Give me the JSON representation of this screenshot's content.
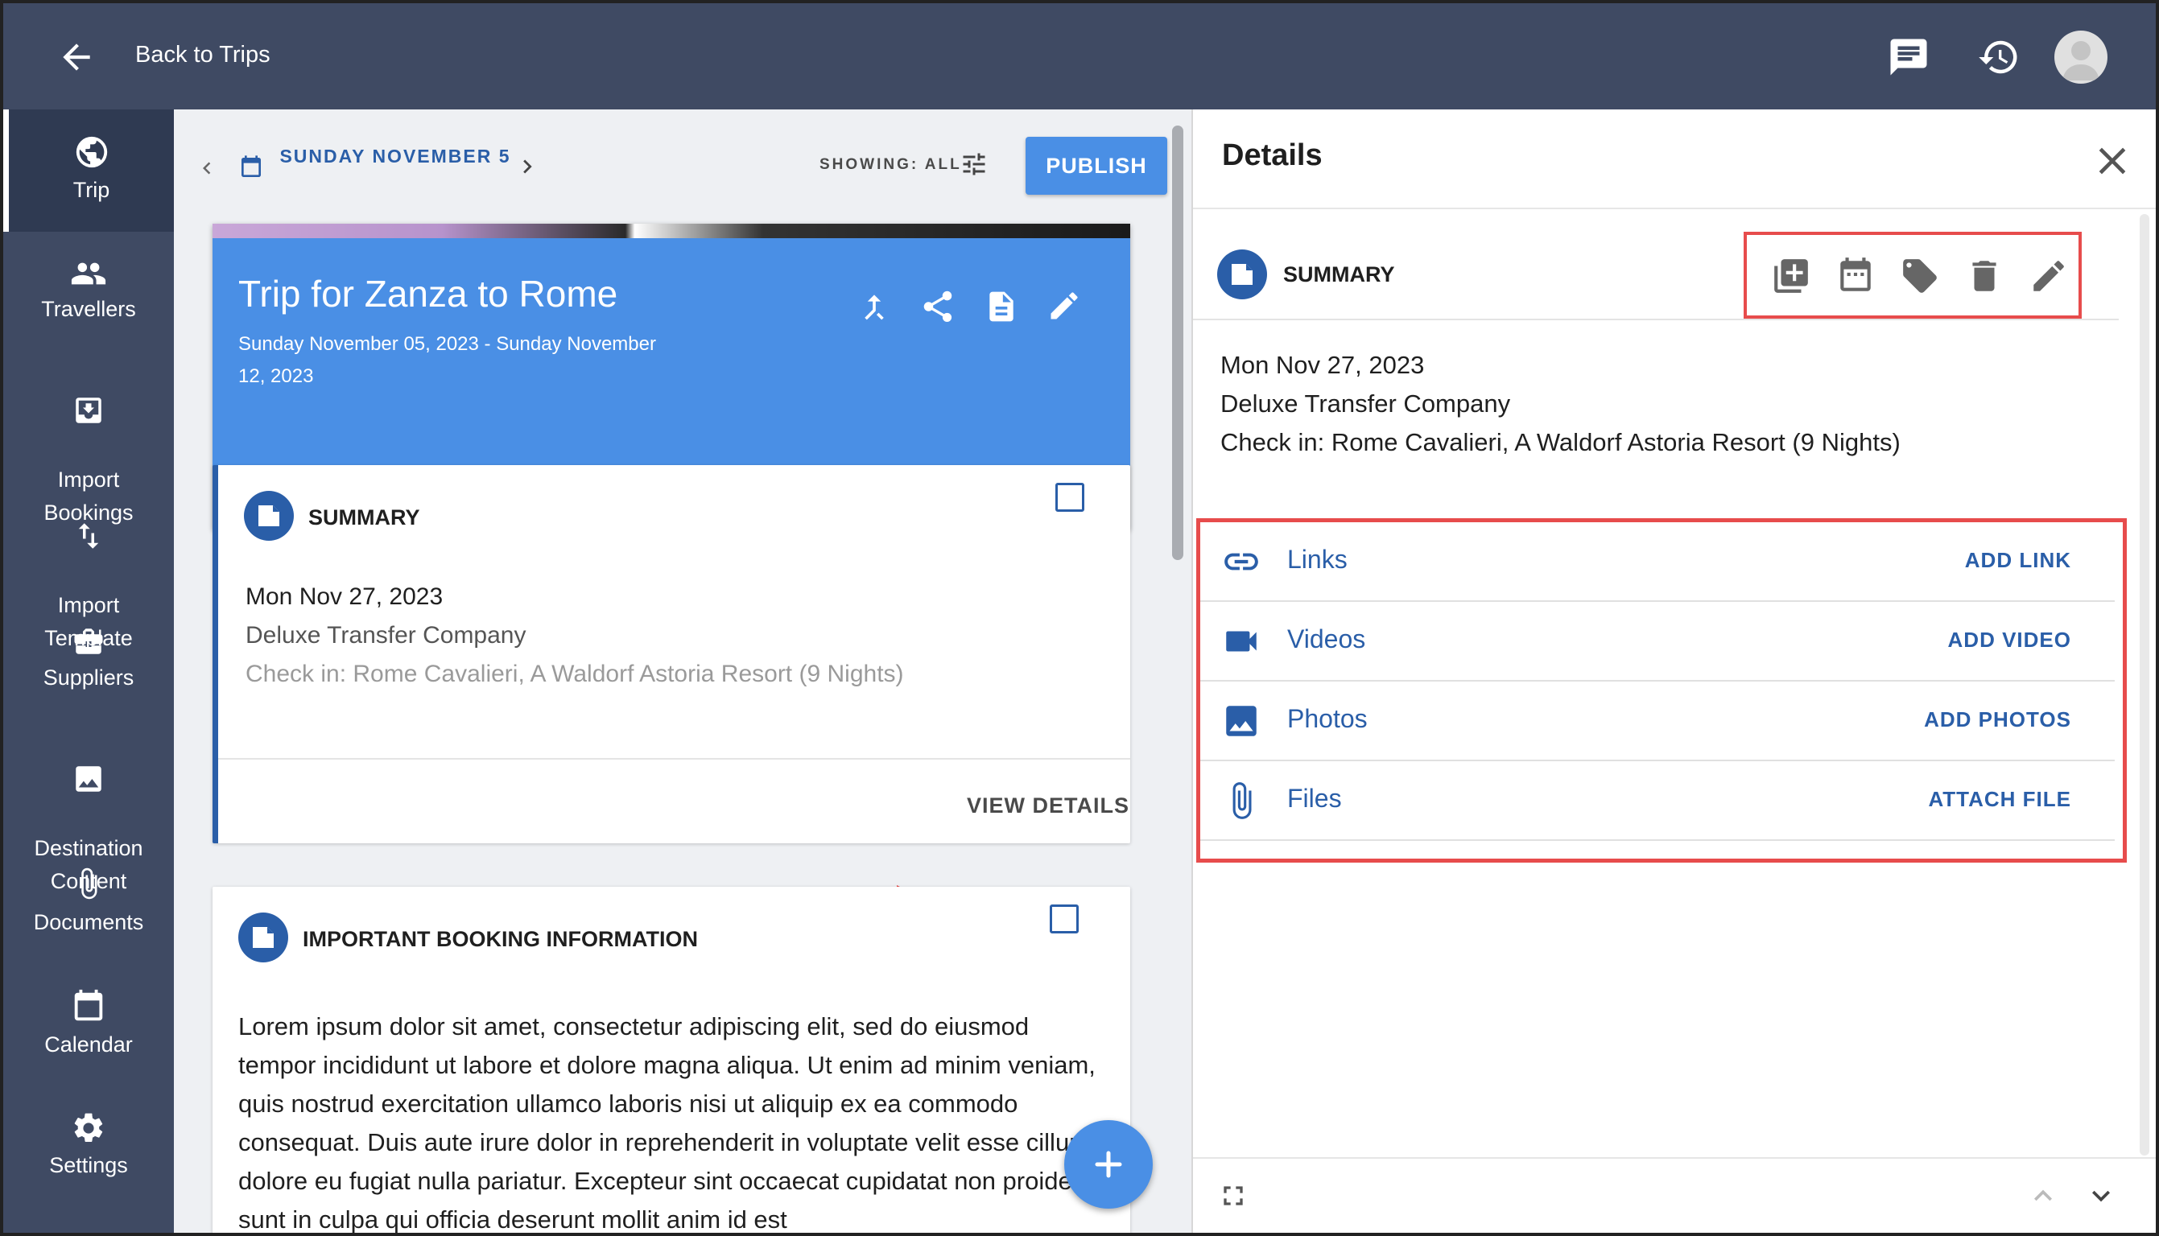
{
  "header": {
    "back_label": "Back to Trips"
  },
  "sidebar": {
    "items": [
      {
        "label": "Trip"
      },
      {
        "label": "Travellers"
      },
      {
        "label": "Import\nBookings"
      },
      {
        "label": "Import\nTemplate"
      },
      {
        "label": "Suppliers"
      },
      {
        "label": "Destination\nContent"
      },
      {
        "label": "Documents"
      },
      {
        "label": "Calendar"
      },
      {
        "label": "Settings"
      }
    ]
  },
  "toolbar": {
    "date_label": "SUNDAY NOVEMBER 5",
    "showing_label": "SHOWING: ALL",
    "publish_label": "PUBLISH"
  },
  "trip": {
    "title": "Trip for Zanza to Rome",
    "dates": "Sunday November 05, 2023 - Sunday November 12, 2023"
  },
  "summary_card": {
    "title": "SUMMARY",
    "lines": [
      "Mon Nov 27, 2023",
      "Deluxe Transfer Company",
      "Check in: Rome Cavalieri, A Waldorf Astoria Resort (9 Nights)"
    ],
    "view_details": "VIEW DETAILS"
  },
  "booking_card": {
    "title": "IMPORTANT BOOKING INFORMATION",
    "text": "Lorem ipsum dolor sit amet, consectetur adipiscing elit, sed do eiusmod tempor incididunt ut labore et dolore magna aliqua. Ut enim ad minim veniam, quis nostrud exercitation ullamco laboris nisi ut aliquip ex ea commodo consequat. Duis aute irure dolor in reprehenderit in voluptate velit esse cillum dolore eu fugiat nulla pariatur. Excepteur sint occaecat cupidatat non proident, sunt in culpa qui officia deserunt mollit anim id est"
  },
  "details": {
    "title": "Details",
    "section_title": "SUMMARY",
    "lines": [
      "Mon Nov 27, 2023",
      "Deluxe Transfer Company",
      "Check in: Rome Cavalieri, A Waldorf Astoria Resort (9 Nights)"
    ],
    "media": [
      {
        "label": "Links",
        "action": "ADD LINK",
        "icon": "link-icon"
      },
      {
        "label": "Videos",
        "action": "ADD VIDEO",
        "icon": "video-icon"
      },
      {
        "label": "Photos",
        "action": "ADD PHOTOS",
        "icon": "image-icon"
      },
      {
        "label": "Files",
        "action": "ATTACH FILE",
        "icon": "paperclip-icon"
      }
    ]
  },
  "colors": {
    "nav_bg": "#3f4a63",
    "accent_blue": "#4a8fe5",
    "link_blue": "#2a5ea8",
    "highlight_red": "#e74c4c"
  }
}
